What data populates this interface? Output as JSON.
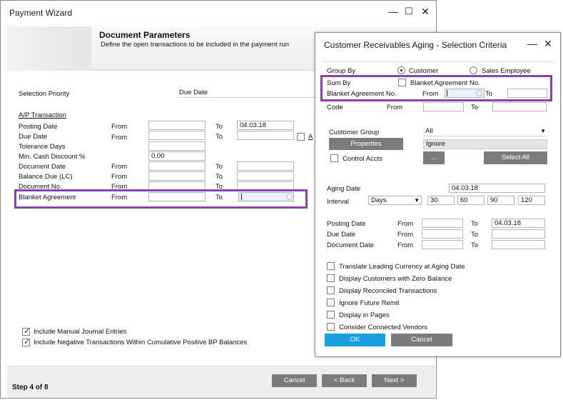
{
  "payment_wizard": {
    "title": "Payment Wizard",
    "header_title": "Document Parameters",
    "header_subtitle": "Define the open transactions to be included in the payment run",
    "selection_priority_label": "Selection Priority",
    "selection_priority_value": "Due Date",
    "ap_transaction_label": "A/P Transaction",
    "from": "From",
    "to": "To",
    "rows": {
      "posting_date": {
        "label": "Posting Date",
        "to_value": "04.03.18"
      },
      "due_date": {
        "label": "Due Date",
        "extra_check": "A"
      },
      "tolerance_days": {
        "label": "Tolerance Days"
      },
      "min_cash_discount": {
        "label": "Min. Cash Discount %",
        "value": "0.00"
      },
      "document_date": {
        "label": "Document Date"
      },
      "balance_due": {
        "label": "Balance Due (LC)"
      },
      "document_no": {
        "label": "Document No."
      },
      "blanket_agreement": {
        "label": "Blanket Agreement"
      }
    },
    "include_manual": "Include Manual Journal Entries",
    "include_negative": "Include Negative Transactions Within Cumulative Positive BP Balances",
    "step": "Step 4 of 8",
    "cancel": "Cancel",
    "back": "< Back",
    "next": "Next >"
  },
  "aging": {
    "title": "Customer Receivables Aging - Selection Criteria",
    "group_by": "Group By",
    "customer": "Customer",
    "sales_employee": "Sales Employee",
    "sum_by": "Sum By",
    "blanket_agreement_no_check": "Blanket Agreement No.",
    "blanket_agreement_no": "Blanket Agreement No.",
    "from": "From",
    "to": "To",
    "code": "Code",
    "customer_group": "Customer Group",
    "customer_group_value": "All",
    "properties": "Properties",
    "ignore": "Ignore",
    "control_accts": "Control Accts",
    "ellipsis": "...",
    "select_all": "Select All",
    "aging_date": "Aging Date",
    "aging_date_value": "04.03.18",
    "interval": "Interval",
    "interval_value": "Days",
    "intervals": [
      "30",
      "60",
      "90",
      "120"
    ],
    "posting_date": "Posting Date",
    "posting_to_value": "04.03.18",
    "due_date": "Due Date",
    "document_date": "Document Date",
    "options": [
      "Translate Leading Currency at Aging Date",
      "Display Customers with Zero Balance",
      "Display Reconciled Transactions",
      "Ignore Future Remit",
      "Display in Pages",
      "Consider Connected Vendors"
    ],
    "ok": "OK",
    "cancel": "Cancel"
  },
  "icons": {
    "minimize": "minimize-icon",
    "maximize": "maximize-icon",
    "close": "close-icon",
    "calendar": "calendar-icon",
    "dropdown": "chevron-down-icon",
    "checkmark": "checkmark-icon"
  },
  "colors": {
    "highlight": "#8e3fa8",
    "primary_button": "#1a9fe0",
    "button": "#7b7b7b"
  }
}
